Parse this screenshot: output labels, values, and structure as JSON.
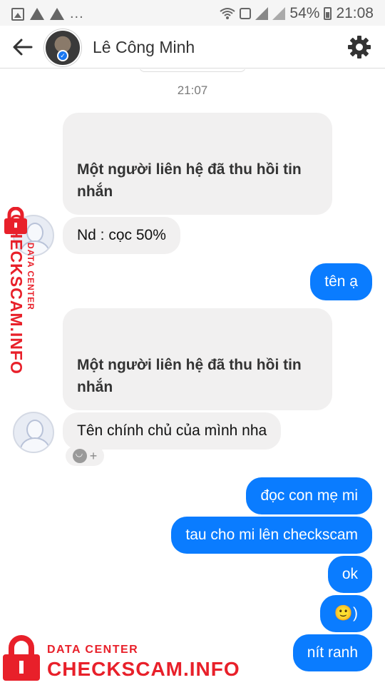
{
  "status_bar": {
    "left_icons": [
      "image-icon",
      "warning-icon",
      "warning-icon"
    ],
    "more": "...",
    "battery": "54%",
    "time": "21:08"
  },
  "header": {
    "contact_name": "Lê Công Minh",
    "back_icon": "arrow-left-icon",
    "settings_icon": "gear-icon"
  },
  "conversation": {
    "timestamp": "21:07",
    "messages": [
      {
        "side": "in",
        "text": "Một người liên hệ đã thu hồi tin nhắn",
        "recalled": true
      },
      {
        "side": "in",
        "text": "Nd : cọc 50%"
      },
      {
        "side": "out",
        "text": "tên ạ"
      },
      {
        "side": "in",
        "text": "Một người liên hệ đã thu hồi tin nhắn",
        "recalled": true
      },
      {
        "side": "in",
        "text": "Tên chính chủ của mình nha"
      },
      {
        "side": "out",
        "text": "đọc con mẹ mi"
      },
      {
        "side": "out",
        "text": "tau cho mi lên checkscam"
      },
      {
        "side": "out",
        "text": "ok"
      },
      {
        "side": "out",
        "text": "🙂)"
      },
      {
        "side": "out",
        "text": "nít ranh"
      }
    ],
    "reaction_plus": "+"
  },
  "watermark": {
    "small_text": "DATA CENTER",
    "big_text": "CHECKSCAM.INFO",
    "color": "#e8202a"
  },
  "colors": {
    "outgoing_bubble": "#0a7cff",
    "incoming_bubble": "#f1f0f0"
  }
}
